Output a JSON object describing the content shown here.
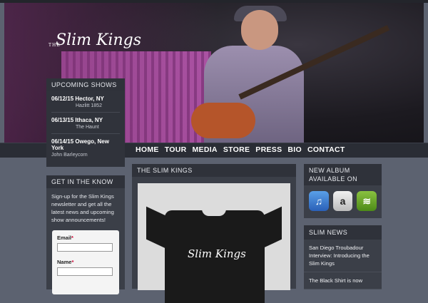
{
  "site": {
    "logo_small": "THE",
    "logo_name": "Slim Kings"
  },
  "nav": [
    "HOME",
    "TOUR",
    "MEDIA",
    "STORE",
    "PRESS",
    "BIO",
    "CONTACT"
  ],
  "upcoming_shows": {
    "title": "UPCOMING SHOWS",
    "items": [
      {
        "date_city": "06/12/15 Hector, NY",
        "venue": "Hazlitt 1852"
      },
      {
        "date_city": "06/13/15 Ithaca, NY",
        "venue": "The Haunt"
      },
      {
        "date_city": "06/14/15 Owego, New York",
        "venue": "John Barleycorn"
      }
    ]
  },
  "get_in_the_know": {
    "title": "GET IN THE KNOW",
    "text": "Sign-up for the Slim Kings newsletter and get all the latest news and upcoming show announcements!",
    "email_label": "Email",
    "name_label": "Name",
    "required_mark": "*"
  },
  "main": {
    "title": "THE SLIM KINGS",
    "shirt_logo": "Slim Kings"
  },
  "new_album": {
    "title": "NEW ALBUM AVAILABLE ON",
    "stores": [
      {
        "icon": "itunes-icon",
        "glyph": "♫"
      },
      {
        "icon": "amazon-icon",
        "glyph": "a"
      },
      {
        "icon": "spotify-icon",
        "glyph": "≋"
      }
    ]
  },
  "slim_news": {
    "title": "SLIM NEWS",
    "items": [
      "San Diego Troubadour Interview: Introducing the Slim Kings",
      "The Black Shirt is now"
    ]
  }
}
